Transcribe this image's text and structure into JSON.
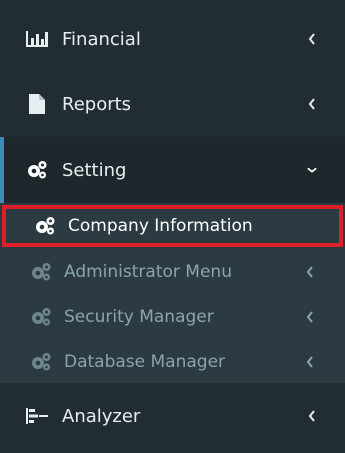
{
  "sidebar": {
    "items": [
      {
        "label": "Financial",
        "icon": "bar-chart-icon"
      },
      {
        "label": "Reports",
        "icon": "file-icon"
      },
      {
        "label": "Setting",
        "icon": "gears-icon",
        "expanded": true
      },
      {
        "label": "Analyzer",
        "icon": "analyzer-icon"
      }
    ],
    "setting_submenu": [
      {
        "label": "Company Information",
        "icon": "gears-icon",
        "highlighted": true
      },
      {
        "label": "Administrator Menu",
        "icon": "gears-icon"
      },
      {
        "label": "Security Manager",
        "icon": "gears-icon"
      },
      {
        "label": "Database Manager",
        "icon": "gears-icon"
      }
    ]
  },
  "colors": {
    "sidebar_bg": "#222d32",
    "submenu_bg": "#2c3b41",
    "active_border": "#3c8dbc",
    "highlight_border": "#dd1f26"
  }
}
